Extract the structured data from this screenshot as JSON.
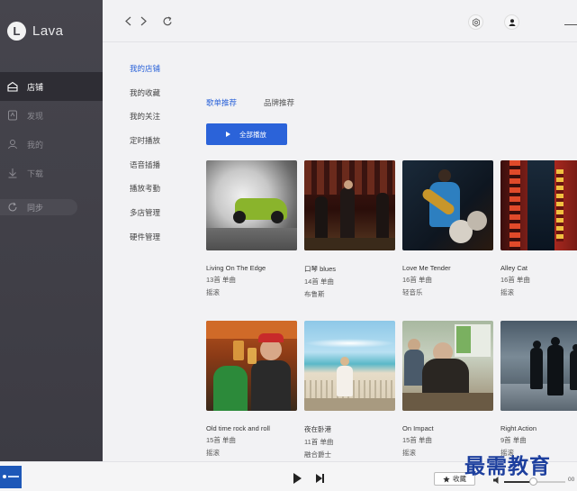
{
  "app": {
    "name": "Lava",
    "logo_letter": "L"
  },
  "sidebar": {
    "items": [
      {
        "label": "店铺",
        "icon": "store-icon",
        "active": true
      },
      {
        "label": "发现",
        "icon": "compass-icon",
        "active": false
      },
      {
        "label": "我的",
        "icon": "user-icon",
        "active": false
      },
      {
        "label": "下载",
        "icon": "download-icon",
        "active": false
      }
    ],
    "sync": {
      "label": "同步",
      "icon": "sync-icon"
    }
  },
  "topbar": {
    "back_icon": "chevron-left-icon",
    "forward_icon": "chevron-right-icon",
    "refresh_icon": "refresh-icon",
    "settings_icon": "gear-icon",
    "user_icon": "user-icon"
  },
  "subnav": {
    "items": [
      {
        "label": "我的店铺",
        "active": true
      },
      {
        "label": "我的收藏",
        "active": false
      },
      {
        "label": "我的关注",
        "active": false
      },
      {
        "label": "定时播放",
        "active": false
      },
      {
        "label": "语音插播",
        "active": false
      },
      {
        "label": "播放考勤",
        "active": false
      },
      {
        "label": "多店管理",
        "active": false
      },
      {
        "label": "硬件管理",
        "active": false
      }
    ]
  },
  "tabs": [
    {
      "label": "歌单推荐",
      "active": true
    },
    {
      "label": "品牌推荐",
      "active": false
    }
  ],
  "play_all_label": "全部播放",
  "playlists": [
    {
      "title": "Living On The Edge",
      "count": "13首 单曲",
      "genre": "摇滚"
    },
    {
      "title": "口琴 blues",
      "count": "14首 单曲",
      "genre": "布鲁斯"
    },
    {
      "title": "Love Me Tender",
      "count": "16首 单曲",
      "genre": "轻音乐"
    },
    {
      "title": "Alley Cat",
      "count": "16首 单曲",
      "genre": "摇滚"
    },
    {
      "title": "Old time rock and roll",
      "count": "15首 单曲",
      "genre": "摇滚"
    },
    {
      "title": "夜在卧港",
      "count": "11首 单曲",
      "genre": "融合爵士"
    },
    {
      "title": "On Impact",
      "count": "15首 单曲",
      "genre": "摇滚"
    },
    {
      "title": "Right Action",
      "count": "9首 单曲",
      "genre": "摇滚"
    }
  ],
  "player": {
    "favorite_label": "收藏",
    "time": "00",
    "volume": 0.47
  },
  "watermark": "最需教育",
  "colors": {
    "accent": "#2b63d9",
    "sidebar": "#3c3b43",
    "sidebar_active": "#2e2d34"
  }
}
